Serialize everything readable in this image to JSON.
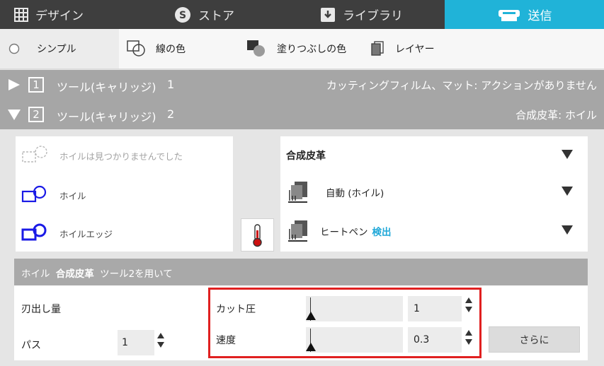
{
  "top_tabs": [
    {
      "label": "デザイン",
      "icon": "grid-icon"
    },
    {
      "label": "ストア",
      "icon": "store-s-icon"
    },
    {
      "label": "ライブラリ",
      "icon": "library-download-icon"
    },
    {
      "label": "送信",
      "icon": "send-cutter-icon",
      "active": true
    }
  ],
  "toolbar": {
    "simple": "シンプル",
    "line_color": "線の色",
    "fill_color": "塗りつぶしの色",
    "layer": "レイヤー"
  },
  "tools": [
    {
      "index": "1",
      "name": "ツール(キャリッジ)",
      "number": "1",
      "status": "カッティングフィルム、マット: アクションがありません",
      "expanded": false
    },
    {
      "index": "2",
      "name": "ツール(キャリッジ)",
      "number": "2",
      "status": "合成皮革: ホイル",
      "expanded": true
    }
  ],
  "holder_options": [
    {
      "label": "ホイルは見つかりませんでした",
      "enabled": false
    },
    {
      "label": "ホイル",
      "enabled": true
    },
    {
      "label": "ホイルエッジ",
      "enabled": true
    }
  ],
  "material": {
    "label": "合成皮革",
    "action": "自動 (ホイル)",
    "tool_prefix": "ヒートペン",
    "tool_detect": "検出"
  },
  "info_bar": {
    "prefix": "ホイル",
    "material": "合成皮革",
    "suffix": "ツール2を用いて"
  },
  "settings": {
    "blade_label": "刃出し量",
    "passes_label": "パス",
    "passes_value": "1",
    "force_label": "カット圧",
    "force_value": "1",
    "speed_label": "速度",
    "speed_value": "0.3",
    "more_label": "さらに"
  },
  "colors": {
    "accent": "#20b3d8",
    "icon_blue": "#1a1ae6",
    "highlight": "#e02020",
    "link": "#20a8d8"
  }
}
